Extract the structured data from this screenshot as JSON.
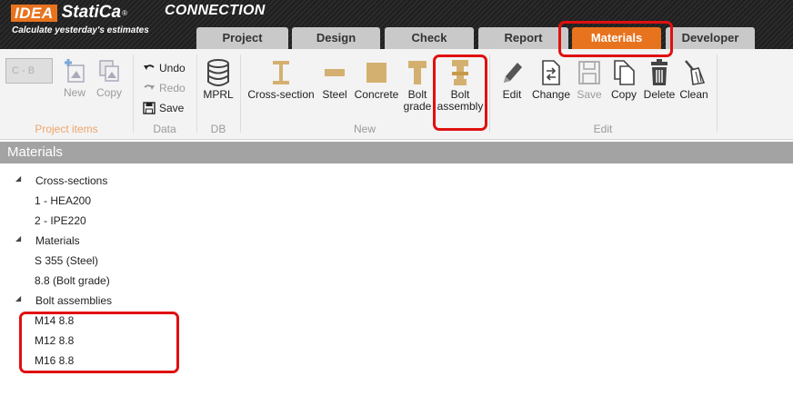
{
  "app": {
    "logo_brand": "IDEA",
    "logo_name": "StatiCa",
    "logo_reg": "®",
    "product": "CONNECTION",
    "slogan": "Calculate yesterday's estimates"
  },
  "tabs": [
    {
      "label": "Project",
      "active": false
    },
    {
      "label": "Design",
      "active": false
    },
    {
      "label": "Check",
      "active": false
    },
    {
      "label": "Report",
      "active": false
    },
    {
      "label": "Materials",
      "active": true
    },
    {
      "label": "Developer",
      "active": false
    }
  ],
  "ribbon": {
    "project_items": {
      "combo_value": "C - B",
      "new_label": "New",
      "copy_label": "Copy",
      "group_label": "Project items"
    },
    "data": {
      "undo_label": "Undo",
      "redo_label": "Redo",
      "save_label": "Save",
      "group_label": "Data"
    },
    "db": {
      "mprl_label": "MPRL",
      "group_label": "DB"
    },
    "new": {
      "cross_section_label": "Cross-section",
      "steel_label": "Steel",
      "concrete_label": "Concrete",
      "bolt_grade_label_1": "Bolt",
      "bolt_grade_label_2": "grade",
      "bolt_assembly_label_1": "Bolt",
      "bolt_assembly_label_2": "assembly",
      "group_label": "New"
    },
    "edit": {
      "edit_label": "Edit",
      "change_label": "Change",
      "save_label": "Save",
      "copy_label": "Copy",
      "delete_label": "Delete",
      "clean_label": "Clean",
      "group_label": "Edit"
    }
  },
  "panel": {
    "title": "Materials"
  },
  "tree": {
    "cross_sections": {
      "label": "Cross-sections",
      "items": [
        "1 - HEA200",
        "2 - IPE220"
      ]
    },
    "materials": {
      "label": "Materials",
      "items": [
        "S 355 (Steel)",
        "8.8 (Bolt grade)"
      ]
    },
    "bolt_assemblies": {
      "label": "Bolt assemblies",
      "items": [
        "M14 8.8",
        "M12 8.8",
        "M16 8.8"
      ]
    }
  },
  "colors": {
    "accent": "#e8731e",
    "highlight": "#e01010",
    "material_icon": "#d4b070"
  },
  "icons": {
    "collapse_glyph": "◢"
  }
}
